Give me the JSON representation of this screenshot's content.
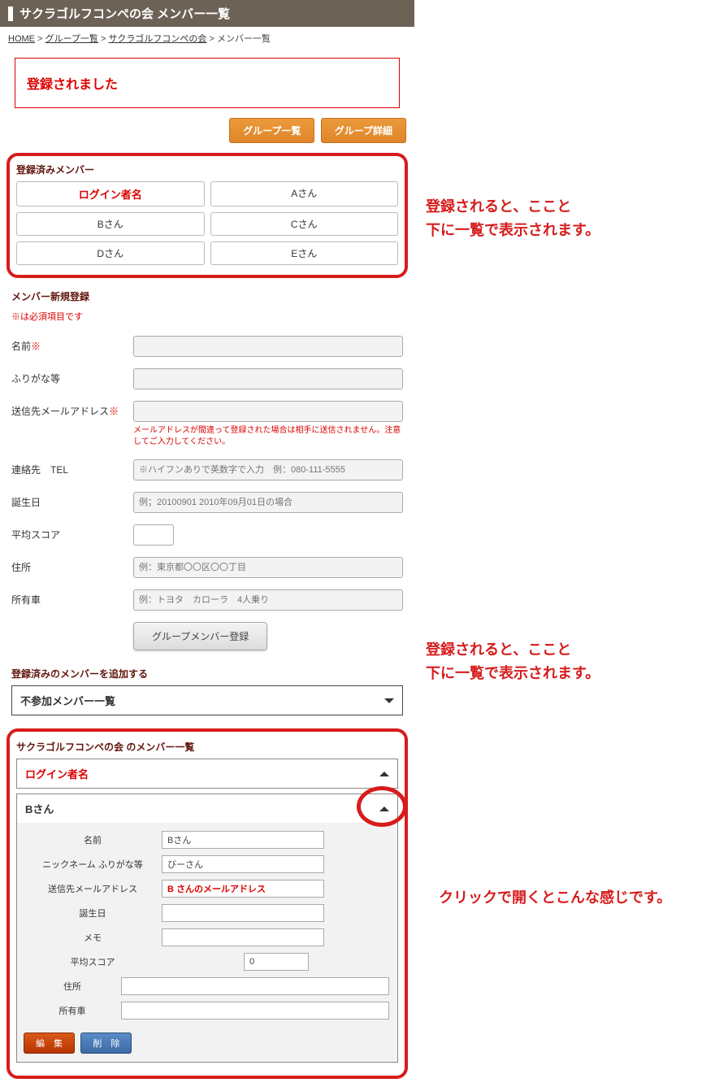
{
  "header": {
    "title": "サクラゴルフコンペの会 メンバー一覧"
  },
  "breadcrumb": {
    "home": "HOME",
    "groups": "グループ一覧",
    "group": "サクラゴルフコンペの会",
    "current": "メンバー一覧",
    "sep": " > "
  },
  "alert": "登録されました",
  "buttons": {
    "group_list": "グループ一覧",
    "group_detail": "グループ詳細",
    "register_member": "グループメンバー登録",
    "edit": "編　集",
    "delete": "削　除"
  },
  "registered": {
    "title": "登録済みメンバー",
    "members": [
      "ログイン者名",
      "Aさん",
      "Bさん",
      "Cさん",
      "Dさん",
      "Eさん"
    ]
  },
  "newreg": {
    "title": "メンバー新規登録",
    "required_note": "※は必須項目です",
    "fields": {
      "name": {
        "label": "名前",
        "req": "※"
      },
      "kana": {
        "label": "ふりがな等"
      },
      "email": {
        "label": "送信先メールアドレス",
        "req": "※",
        "note": "メールアドレスが間違って登録された場合は相手に送信されません。注意してご入力してください。"
      },
      "tel": {
        "label": "連絡先　TEL",
        "placeholder": "※ハイフンありで英数字で入力　例：080-111-5555"
      },
      "birthday": {
        "label": "誕生日",
        "placeholder": "例；20100901 2010年09月01日の場合"
      },
      "score": {
        "label": "平均スコア"
      },
      "address": {
        "label": "住所",
        "placeholder": "例：東京都〇〇区〇〇丁目"
      },
      "car": {
        "label": "所有車",
        "placeholder": "例：トヨタ　カローラ　4人乗り"
      }
    }
  },
  "addsection": {
    "title": "登録済みのメンバーを追加する",
    "dropdown": "不参加メンバー一覧"
  },
  "memberlist": {
    "title": "サクラゴルフコンペの会 のメンバー一覧",
    "item1": "ログイン者名",
    "item2": {
      "name_head": "Bさん",
      "fields": {
        "name": {
          "label": "名前",
          "value": "Bさん"
        },
        "nick": {
          "label": "ニックネーム ふりがな等",
          "value": "びーさん"
        },
        "email": {
          "label": "送信先メールアドレス",
          "value": "B さんのメールアドレス"
        },
        "birthday": {
          "label": "誕生日",
          "value": ""
        },
        "memo": {
          "label": "メモ",
          "value": ""
        },
        "score": {
          "label": "平均スコア",
          "value": "0"
        },
        "address": {
          "label": "住所",
          "value": ""
        },
        "car": {
          "label": "所有車",
          "value": ""
        }
      }
    }
  },
  "annotations": {
    "a1": "登録されると、ここと\n下に一覧で表示されます。",
    "a2": "登録されると、ここと\n下に一覧で表示されます。",
    "a3": "クリックで開くとこんな感じです。"
  }
}
